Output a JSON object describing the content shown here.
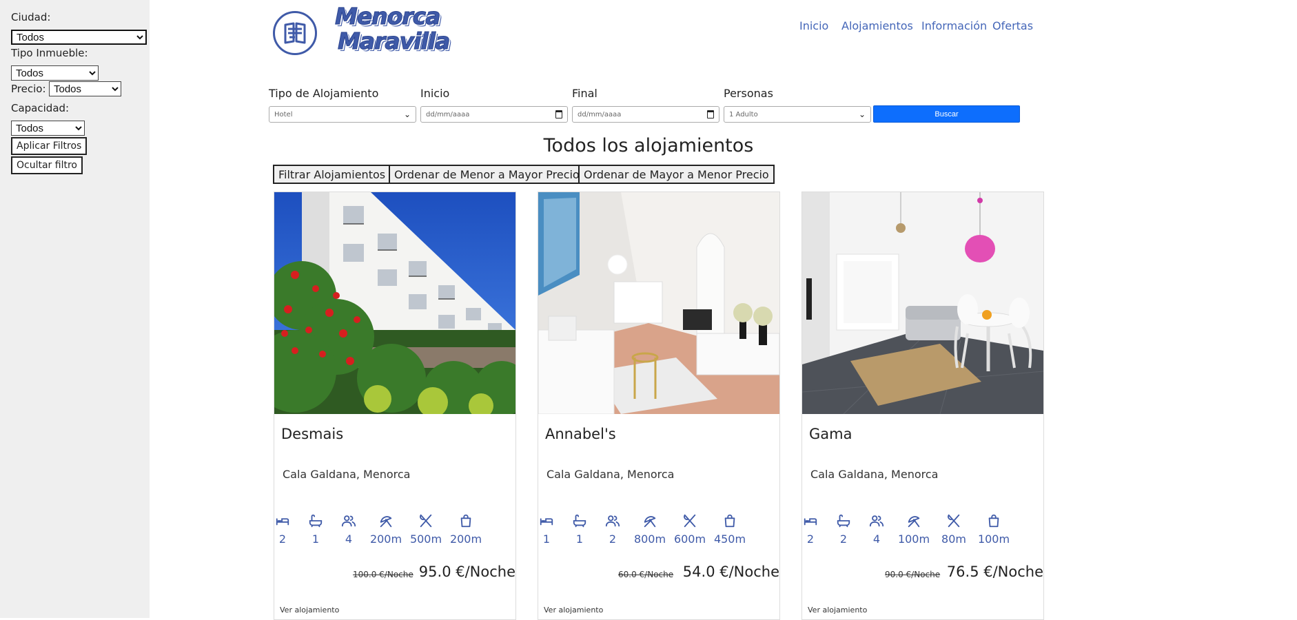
{
  "sidebar": {
    "city_label": "Ciudad:",
    "city_value": "Todos",
    "type_label": "Tipo Inmueble:",
    "type_value": "Todos",
    "price_label": "Precio:",
    "price_value": "Todos",
    "capacity_label": "Capacidad:",
    "capacity_value": "Todos",
    "apply_label": "Aplicar Filtros",
    "hide_label": "Ocultar filtro"
  },
  "header": {
    "logo_line1": "Menorca",
    "logo_line2": "Maravilla",
    "nav": [
      "Inicio",
      "Alojamientos",
      "Información",
      "Ofertas"
    ]
  },
  "search": {
    "type_label": "Tipo de Alojamiento",
    "type_value": "Hotel",
    "start_label": "Inicio",
    "start_placeholder": "dd/mm/aaaa",
    "end_label": "Final",
    "end_placeholder": "dd/mm/aaaa",
    "people_label": "Personas",
    "people_value": "1 Adulto",
    "button_label": "Buscar"
  },
  "main": {
    "title": "Todos los alojamientos",
    "buttons": [
      "Filtrar Alojamientos",
      "Ordenar de Menor a Mayor Precio",
      "Ordenar de Mayor a Menor Precio"
    ]
  },
  "cards": [
    {
      "name": "Desmais",
      "location": "Cala Galdana, Menorca",
      "amenities": [
        "2",
        "1",
        "4",
        "200m",
        "500m",
        "200m"
      ],
      "old_price": "100.0 €/Noche",
      "price": "95.0 €/Noche",
      "link": "Ver alojamiento"
    },
    {
      "name": "Annabel's",
      "location": "Cala Galdana, Menorca",
      "amenities": [
        "1",
        "1",
        "2",
        "800m",
        "600m",
        "450m"
      ],
      "old_price": "60.0 €/Noche",
      "price": "54.0 €/Noche",
      "link": "Ver alojamiento"
    },
    {
      "name": "Gama",
      "location": "Cala Galdana, Menorca",
      "amenities": [
        "2",
        "2",
        "4",
        "100m",
        "80m",
        "100m"
      ],
      "old_price": "90.0 €/Noche",
      "price": "76.5 €/Noche",
      "link": "Ver alojamiento"
    }
  ],
  "amenity_icons": [
    "bed-icon",
    "bathtub-icon",
    "people-icon",
    "beach-icon",
    "restaurant-icon",
    "shopping-bag-icon"
  ],
  "colors": {
    "accent": "#3f5aa8",
    "button": "#0d6efd",
    "sidebar_bg": "#efefef"
  }
}
